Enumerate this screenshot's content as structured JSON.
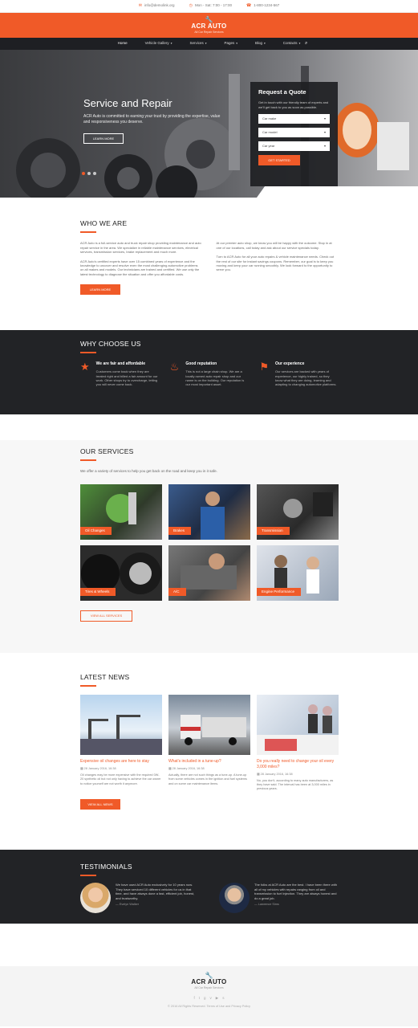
{
  "topbar": {
    "email": "info@demolink.org",
    "hours": "Mon - Sat: 7:00 - 17:00",
    "phone": "1-800-1234-567"
  },
  "brand": {
    "name": "ACR AUTO",
    "tagline": "All Car Repair Services"
  },
  "nav": {
    "items": [
      "Home",
      "Vehicle Gallery",
      "Services",
      "Pages",
      "Blog",
      "Contacts"
    ]
  },
  "hero": {
    "title": "Service and Repair",
    "text": "ACR Auto is committed to earning your trust by providing the expertise, value and responsiveness you deserve.",
    "button": "LEARN MORE"
  },
  "quote": {
    "title": "Request a Quote",
    "text": "Get in touch with our friendly team of experts and we'll get back to you as soon as possible.",
    "make": "Car make",
    "model": "Car model",
    "year": "Car year",
    "button": "GET STARTED"
  },
  "who": {
    "title": "WHO WE ARE",
    "p1": "ACR Auto is a full-service auto and truck repair shop providing maintenance and auto repair service in the area. We specialize in reliable maintenance services, electrical services, transmission services, brake replacement and much more.",
    "p2": "ACR Auto's certified experts have over 15 combined years of experience and the knowledge to uncover and resolve even the most challenging automotive problems on all makes and models. Our technicians are trained and certified. We use only the latest technology to diagnose the situation and offer you affordable costs.",
    "p3": "At our premier auto shop, we know you will be happy with the outcome. Stop in at one of our locations, call today and ask about our service specials today.",
    "p4": "Turn to ACR Auto for all your auto repairs & vehicle maintenance needs. Check out the rest of our site for instant savings coupons. Remember, our goal is to keep you moving and keep your car running smoothly. We look forward to the opportunity to serve you.",
    "button": "LEARN MORE"
  },
  "why": {
    "title": "WHY CHOOSE US",
    "items": [
      {
        "title": "We are fair and affordable",
        "text": "Customers come back when they are treated right and billed a fair amount for our work. Other shops try to overcharge, letting you will never come back."
      },
      {
        "title": "Good reputation",
        "text": "This is not a large chain shop. We are a locally owned auto repair shop and our name is on the building. Our reputation is our most important asset."
      },
      {
        "title": "Our experience",
        "text": "Our services are backed with years of experience, our highly trained, so they know what they are doing, learning and adapting to changing automotive platforms."
      }
    ]
  },
  "services": {
    "title": "OUR SERVICES",
    "intro": "We offer a variety of services to help you get back on the road and keep you in it safe.",
    "items": [
      "Oil Changes",
      "Brakes",
      "Transmission",
      "Tires & Wheels",
      "A/C",
      "Engine Performance"
    ],
    "button": "VIEW ALL SERVICES"
  },
  "news": {
    "title": "LATEST NEWS",
    "items": [
      {
        "title": "Expensive oil changes are here to stay",
        "date": "28 January 2016, 16:38",
        "text": "Oil changes may be more expensive with the required 0W-20 synthetic oil but not only having to achieve the car owner to notice yourself are not worth it anymore."
      },
      {
        "title": "What's included in a tune-up?",
        "date": "28 January 2016, 16:38",
        "text": "Actually, there are not such things as a tune-up. A tune-up from some vehicles comes in the ignition and fuel systems and on some car maintenance items."
      },
      {
        "title": "Do you really need to change your oil every 3,000 miles?",
        "date": "28 January 2016, 16:38",
        "text": "No, you don't, according to many auto manufacturers, as they have said. The interval has been at 3,000 miles in previous years."
      }
    ],
    "button": "VIEW ALL NEWS"
  },
  "testimonials": {
    "title": "TESTIMONIALS",
    "items": [
      {
        "text": "We have used ACR Auto exclusively for 10 years now. They have serviced 10 different vehicles for us in that time, and have always done a fast, efficient job, honest, and trustworthy.",
        "author": "— Evelyn Walker"
      },
      {
        "text": "The folks at ACR Auto are the best. I have been there with all of my vehicles with repairs ranging from oil and transmission to fuel injection. They are always honest and do a great job.",
        "author": "— Lawrence Sims"
      }
    ]
  },
  "footer": {
    "copyright": "© 2016 All Rights Reserved. Terms of Use and Privacy Policy"
  },
  "colors": {
    "accent": "#f05a28",
    "dark": "#222326"
  }
}
